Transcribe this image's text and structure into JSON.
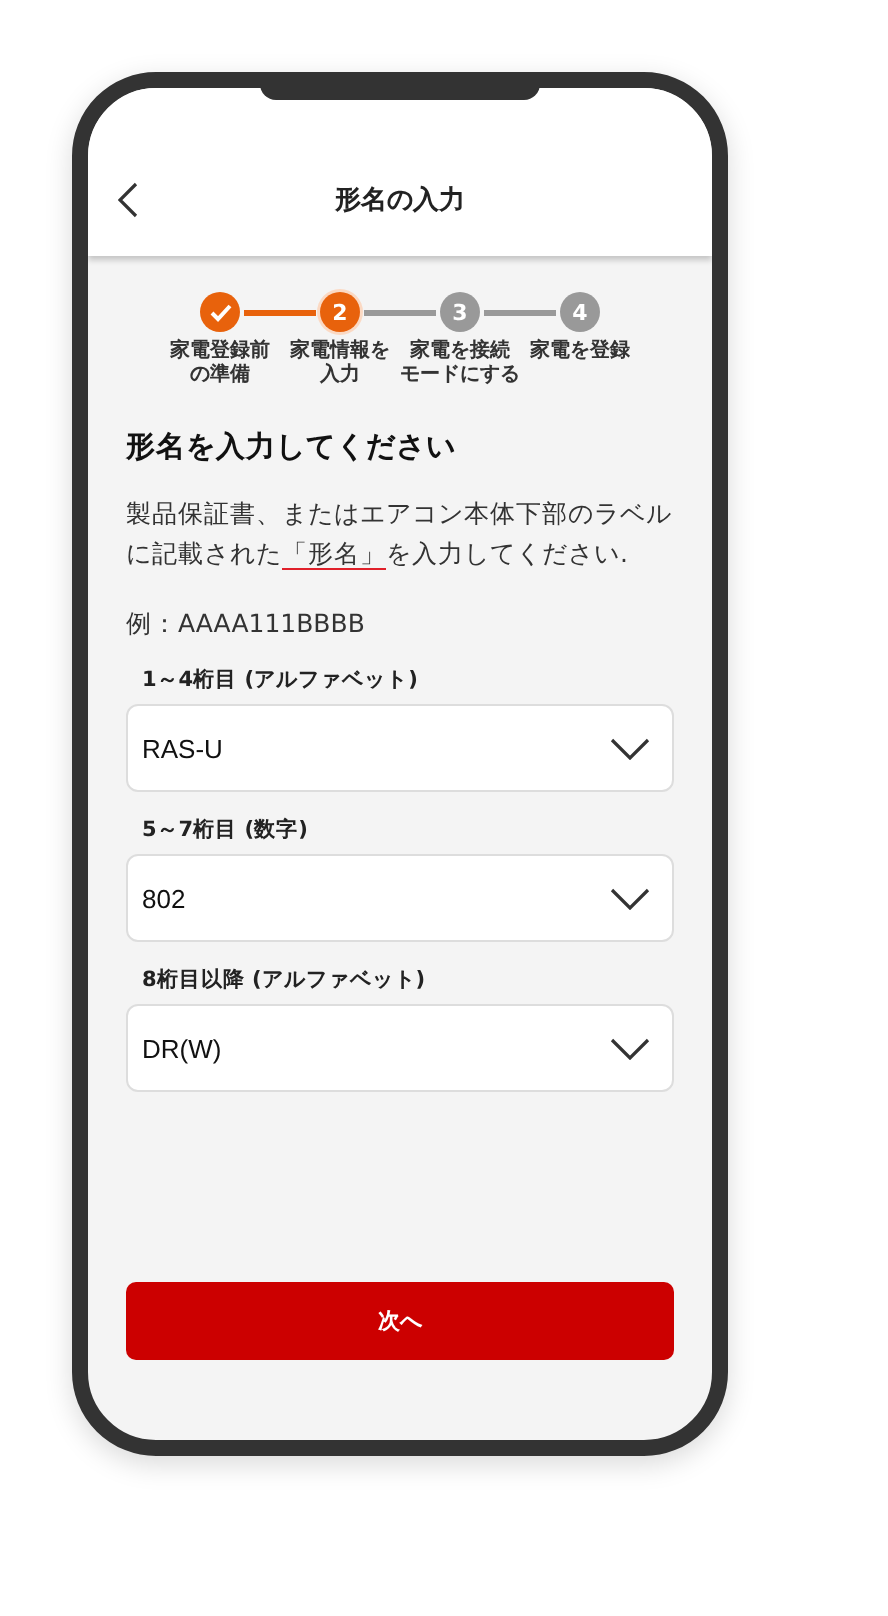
{
  "header": {
    "title": "形名の入力"
  },
  "steps": [
    {
      "label_lines": [
        "家電登録前",
        "の準備"
      ],
      "completed": true,
      "selected": false
    },
    {
      "number": "2",
      "label_lines": [
        "家電情報を",
        "入力"
      ],
      "completed": false,
      "selected": true
    },
    {
      "number": "3",
      "label_lines": [
        "家電を接続",
        "モードにする"
      ],
      "completed": false,
      "selected": false
    },
    {
      "number": "4",
      "label_lines": [
        "家電を登録"
      ],
      "completed": false,
      "selected": false
    }
  ],
  "heading": "形名を入力してください",
  "instruction": {
    "before": "製品保証書、またはエアコン本体下部のラベルに記載された",
    "link": "「形名」",
    "after": "を入力してください."
  },
  "example": "例：AAAA111BBBB",
  "fields": [
    {
      "label": "1～4桁目 (アルファベット)",
      "value": "RAS-U"
    },
    {
      "label": "5～7桁目 (数字)",
      "value": "802"
    },
    {
      "label": "8桁目以降 (アルファベット)",
      "value": "DR(W)"
    }
  ],
  "next_button": "次へ"
}
